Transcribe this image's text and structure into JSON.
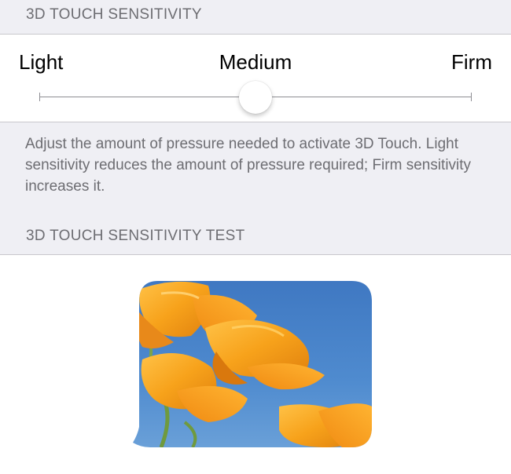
{
  "sensitivity_section": {
    "header": "3D TOUCH SENSITIVITY",
    "slider": {
      "min_label": "Light",
      "mid_label": "Medium",
      "max_label": "Firm",
      "value": 0.5
    },
    "footer": "Adjust the amount of pressure needed to activate 3D Touch. Light sensitivity reduces the amount of pressure required; Firm sensitivity increases it."
  },
  "test_section": {
    "header": "3D TOUCH SENSITIVITY TEST",
    "image": {
      "subject": "orange poppies against blue sky"
    }
  },
  "colors": {
    "background": "#efeff4",
    "cell_background": "#ffffff",
    "secondary_text": "#6d6d72",
    "flower_orange": "#f7a21b",
    "sky_blue": "#4a82c4"
  }
}
